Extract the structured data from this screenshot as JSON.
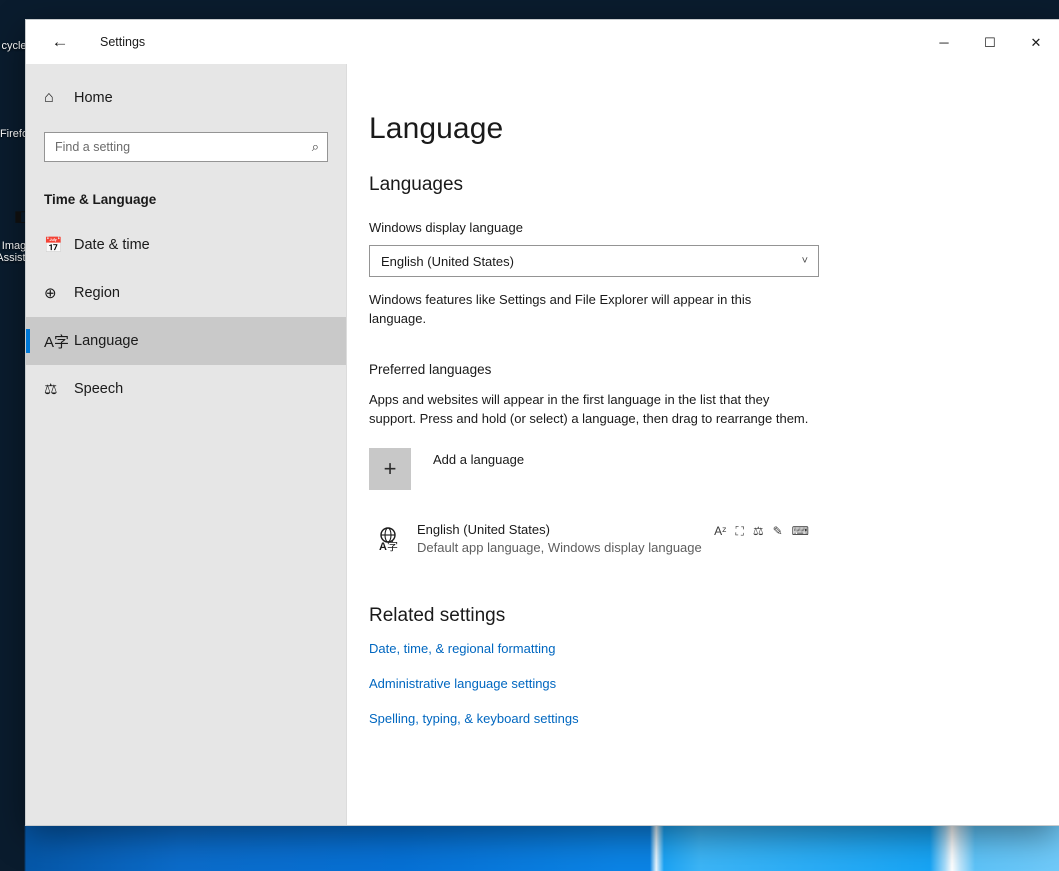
{
  "desktop": {
    "icons": [
      {
        "name": "Recycle Bin",
        "visible_label": "cycle"
      },
      {
        "name": "Firefox",
        "visible_label": "Firefo"
      },
      {
        "name": "Image Assistant",
        "visible_label": "Imag",
        "visible_label2": "Assista"
      }
    ]
  },
  "window": {
    "app_title": "Settings",
    "back_icon": "←",
    "controls": {
      "minimize": "─",
      "maximize": "☐",
      "close": "✕"
    }
  },
  "sidebar": {
    "home_label": "Home",
    "home_icon": "⌂",
    "search": {
      "placeholder": "Find a setting",
      "value": "",
      "icon": "⌕"
    },
    "group_title": "Time & Language",
    "items": [
      {
        "label": "Date & time",
        "icon": "📅",
        "selected": false
      },
      {
        "label": "Region",
        "icon": "⊕",
        "selected": false
      },
      {
        "label": "Language",
        "icon": "A字",
        "selected": true
      },
      {
        "label": "Speech",
        "icon": "⚖",
        "selected": false
      }
    ],
    "accent_color": "#0078d7",
    "selected_bg": "#c9c9c9",
    "background": "#e6e6e6"
  },
  "content": {
    "page_title": "Language",
    "languages_head": "Languages",
    "display_language_label": "Windows display language",
    "display_language_value": "English (United States)",
    "display_language_chevron": "˅",
    "display_language_help": "Windows features like Settings and File Explorer will appear in this language.",
    "preferred_head": "Preferred languages",
    "preferred_help": "Apps and websites will appear in the first language in the list that they support. Press and hold (or select) a language, then drag to rearrange them.",
    "add_language_label": "Add a language",
    "add_language_plus": "+",
    "language_entry": {
      "name": "English (United States)",
      "status": "Default app language, Windows display language",
      "feature_icons": [
        {
          "name": "language-pack-icon",
          "glyph": "Aᶻ"
        },
        {
          "name": "text-to-speech-icon",
          "glyph": "⛶"
        },
        {
          "name": "speech-recognition-icon",
          "glyph": "⚖"
        },
        {
          "name": "handwriting-icon",
          "glyph": "✎"
        },
        {
          "name": "keyboard-icon",
          "glyph": "⌨"
        }
      ]
    },
    "related_head": "Related settings",
    "related_links": [
      "Date, time, & regional formatting",
      "Administrative language settings",
      "Spelling, typing, & keyboard settings"
    ],
    "link_color": "#0067c0"
  }
}
